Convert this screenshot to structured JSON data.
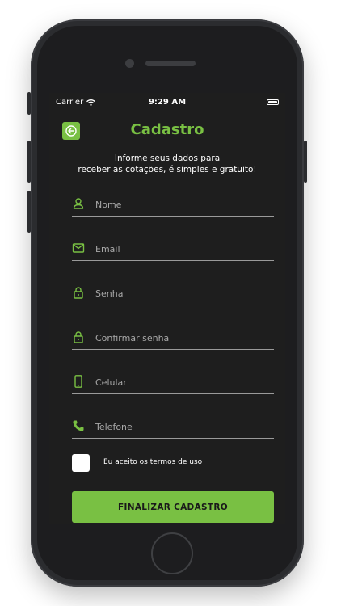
{
  "status_bar": {
    "carrier": "Carrier",
    "time": "9:29 AM"
  },
  "header": {
    "title": "Cadastro"
  },
  "intro": {
    "line1": "Informe seus dados para",
    "line2": "receber as cotações, é simples e gratuito!"
  },
  "fields": [
    {
      "icon": "user-icon",
      "placeholder": "Nome"
    },
    {
      "icon": "mail-icon",
      "placeholder": "Email"
    },
    {
      "icon": "lock-icon",
      "placeholder": "Senha"
    },
    {
      "icon": "lock-icon",
      "placeholder": "Confirmar senha"
    },
    {
      "icon": "smartphone-icon",
      "placeholder": "Celular"
    },
    {
      "icon": "phone-icon",
      "placeholder": "Telefone"
    }
  ],
  "terms": {
    "prefix": "Eu aceito os ",
    "link": "termos de uso",
    "checked": false
  },
  "submit": {
    "label": "FINALIZAR CADASTRO"
  },
  "colors": {
    "accent": "#79c043",
    "background": "#1e1e1e",
    "text": "#ffffff"
  }
}
